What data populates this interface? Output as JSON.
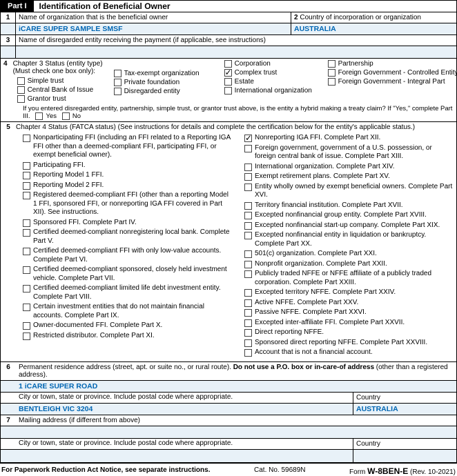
{
  "partTab": "Part I",
  "partTitle": "Identification of Beneficial Owner",
  "line1": {
    "num": "1",
    "label": "Name of organization that is the beneficial owner",
    "value": "iCARE SUPER SAMPLE SMSF"
  },
  "line2": {
    "num": "2",
    "label": "Country of incorporation or organization",
    "value": "AUSTRALIA"
  },
  "line3": {
    "num": "3",
    "label": "Name of disregarded entity receiving the payment (if applicable, see instructions)"
  },
  "line4": {
    "num": "4",
    "label": "Chapter 3 Status (entity type) (Must check one box only):",
    "col1": [
      "Simple trust",
      "Central Bank of Issue",
      "Grantor trust"
    ],
    "col2": [
      "Tax-exempt organization",
      "Private foundation",
      "Disregarded entity"
    ],
    "col3top": "Corporation",
    "col3": [
      "Complex trust",
      "Estate",
      "International organization"
    ],
    "col4top": "Partnership",
    "col4": [
      "Foreign Government - Controlled Entity",
      "Foreign Government - Integral Part"
    ],
    "checked": "Complex trust",
    "treaty": "If you entered disregarded entity, partnership, simple trust, or grantor trust above, is the entity a hybrid making a treaty claim? If \"Yes,\" complete Part III.",
    "yes": "Yes",
    "no": "No"
  },
  "line5": {
    "num": "5",
    "label": "Chapter 4 Status (FATCA status) (See instructions for details and complete the  certification below for the entity's applicable status.)",
    "left": [
      "Nonparticipating FFI (including an FFI related to a Reporting IGA FFI other than a deemed-compliant FFI, participating FFI, or exempt beneficial owner).",
      "Participating FFI.",
      "Reporting Model 1 FFI.",
      "Reporting Model 2 FFI.",
      "Registered deemed-compliant FFI (other than a reporting Model 1 FFI, sponsored FFI, or nonreporting IGA FFI covered in Part XII). See instructions.",
      "Sponsored FFI. Complete Part IV.",
      "Certified deemed-compliant nonregistering local bank. Complete Part V.",
      "Certified deemed-compliant FFI with only low-value accounts. Complete Part VI.",
      "Certified deemed-compliant sponsored, closely held investment vehicle. Complete Part VII.",
      "Certified deemed-compliant limited life debt investment entity. Complete Part VIII.",
      "Certain investment entities that do not maintain financial accounts. Complete Part IX.",
      "Owner-documented FFI. Complete Part X.",
      "Restricted distributor. Complete Part XI."
    ],
    "right": [
      "Nonreporting IGA FFI. Complete Part XII.",
      "Foreign government, government of a U.S. possession, or foreign central bank of issue. Complete Part XIII.",
      "International organization. Complete Part XIV.",
      "Exempt retirement plans. Complete Part XV.",
      "Entity wholly owned by exempt beneficial owners. Complete Part XVI.",
      "Territory financial institution. Complete Part XVII.",
      "Excepted nonfinancial group entity. Complete Part XVIII.",
      "Excepted nonfinancial start-up company. Complete Part XIX.",
      "Excepted nonfinancial entity in liquidation or bankruptcy. Complete Part XX.",
      "501(c) organization. Complete Part XXI.",
      "Nonprofit organization. Complete Part XXII.",
      "Publicly traded NFFE or NFFE affiliate of a publicly traded corporation. Complete Part XXIII.",
      "Excepted territory NFFE. Complete Part XXIV.",
      "Active NFFE. Complete Part XXV.",
      "Passive NFFE. Complete Part XXVI.",
      "Excepted inter-affiliate FFI. Complete Part XXVII.",
      "Direct reporting NFFE.",
      "Sponsored direct reporting NFFE. Complete Part XXVIII.",
      "Account that is not a financial account."
    ],
    "rightChecked": 0
  },
  "line6": {
    "num": "6",
    "label1": "Permanent residence address (street, apt. or suite no., or rural route). ",
    "label2": "Do not use a P.O. box or in-care-of address",
    "label3": " (other than a registered address).",
    "value": "1 iCARE SUPER ROAD",
    "cityLabel": "City or town, state or province. Include postal code where appropriate.",
    "cityValue": "BENTLEIGH VIC 3204",
    "countryLabel": "Country",
    "countryValue": "AUSTRALIA"
  },
  "line7": {
    "num": "7",
    "label": "Mailing address (if different from above)",
    "cityLabel": "City or town, state or province. Include postal code where appropriate.",
    "countryLabel": "Country"
  },
  "footer": {
    "left": "For Paperwork Reduction Act Notice, see separate instructions.",
    "mid": "Cat. No. 59689N",
    "rightPrefix": "Form ",
    "rightForm": "W-8BEN-E",
    "rightSuffix": " (Rev. 10-2021)"
  }
}
